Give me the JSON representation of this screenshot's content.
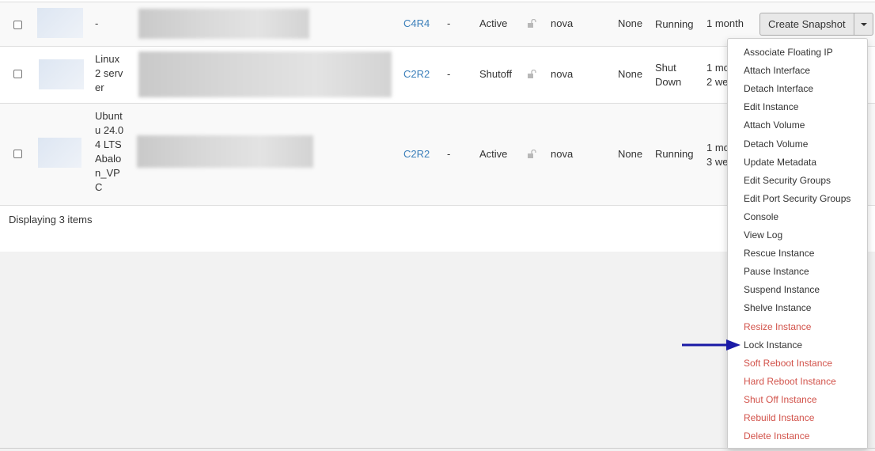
{
  "rows": [
    {
      "name": "-",
      "flavor": "C4R4",
      "keypair": "-",
      "status": "Active",
      "az": "nova",
      "task": "None",
      "power_state": "Running",
      "age": "1 month"
    },
    {
      "name": "Linux 2 server",
      "flavor": "C2R2",
      "keypair": "-",
      "status": "Shutoff",
      "az": "nova",
      "task": "None",
      "power_state": "Shut Down",
      "age": "1 mo 2 we"
    },
    {
      "name": "Ubuntu 24.04 LTS Abalon_VPC",
      "flavor": "C2R2",
      "keypair": "-",
      "status": "Active",
      "az": "nova",
      "task": "None",
      "power_state": "Running",
      "age": "1 mo 3 we"
    }
  ],
  "footer": "Displaying 3 items",
  "actions": {
    "primary": "Create Snapshot",
    "menu": [
      {
        "label": "Associate Floating IP",
        "danger": false
      },
      {
        "label": "Attach Interface",
        "danger": false
      },
      {
        "label": "Detach Interface",
        "danger": false
      },
      {
        "label": "Edit Instance",
        "danger": false
      },
      {
        "label": "Attach Volume",
        "danger": false
      },
      {
        "label": "Detach Volume",
        "danger": false
      },
      {
        "label": "Update Metadata",
        "danger": false
      },
      {
        "label": "Edit Security Groups",
        "danger": false
      },
      {
        "label": "Edit Port Security Groups",
        "danger": false
      },
      {
        "label": "Console",
        "danger": false
      },
      {
        "label": "View Log",
        "danger": false
      },
      {
        "label": "Rescue Instance",
        "danger": false
      },
      {
        "label": "Pause Instance",
        "danger": false
      },
      {
        "label": "Suspend Instance",
        "danger": false
      },
      {
        "label": "Shelve Instance",
        "danger": false
      },
      {
        "label": "Resize Instance",
        "danger": true
      },
      {
        "label": "Lock Instance",
        "danger": false
      },
      {
        "label": "Soft Reboot Instance",
        "danger": true
      },
      {
        "label": "Hard Reboot Instance",
        "danger": true
      },
      {
        "label": "Shut Off Instance",
        "danger": true
      },
      {
        "label": "Rebuild Instance",
        "danger": true
      },
      {
        "label": "Delete Instance",
        "danger": true
      }
    ]
  },
  "colors": {
    "link": "#3b7fba",
    "danger": "#d2524a",
    "arrow": "#1a1aa6"
  },
  "icons": {
    "lock": "unlock-icon",
    "caret": "caret-down-icon",
    "pointer": "arrow-right-icon"
  }
}
